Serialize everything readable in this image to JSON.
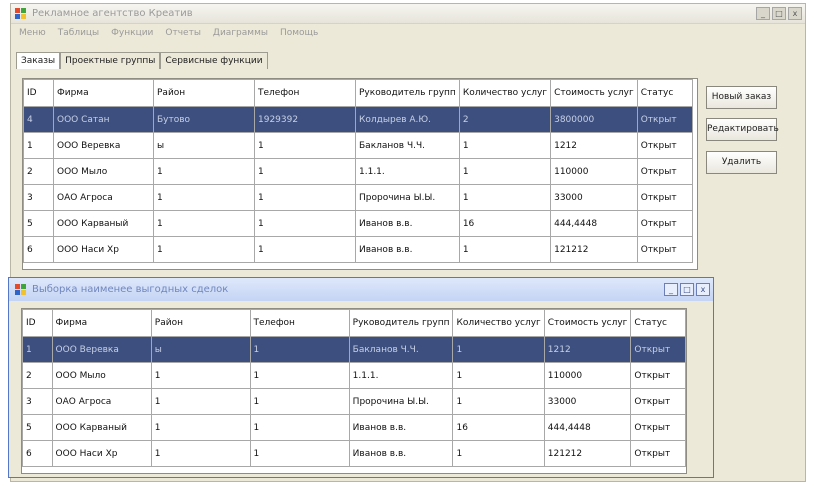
{
  "main_window": {
    "title": "Рекламное агентство Креатив",
    "menu": [
      "Меню",
      "Таблицы",
      "Функции",
      "Отчеты",
      "Диаграммы",
      "Помощь"
    ],
    "tabs": [
      "Заказы",
      "Проектные группы",
      "Сервисные функции"
    ],
    "buttons": {
      "new_order": "Новый заказ",
      "edit": "Редактировать",
      "delete": "Удалить"
    },
    "columns": [
      "ID",
      "Фирма",
      "Район",
      "Телефон",
      "Руководитель групп",
      "Количество услуг",
      "Стоимость услуг",
      "Статус"
    ],
    "rows": [
      [
        "4",
        "ООО Сатан",
        "Бутово",
        "1929392",
        "Колдырев А.Ю.",
        "2",
        "3800000",
        "Открыт"
      ],
      [
        "1",
        "ООО Веревка",
        "ы",
        "1",
        "Бакланов Ч.Ч.",
        "1",
        "1212",
        "Открыт"
      ],
      [
        "2",
        "ООО Мыло",
        "1",
        "1",
        "1.1.1.",
        "1",
        "110000",
        "Открыт"
      ],
      [
        "3",
        "ОАО Агроса",
        "1",
        "1",
        "Пророчина Ы.Ы.",
        "1",
        "33000",
        "Открыт"
      ],
      [
        "5",
        "ООО Карваный",
        "1",
        "1",
        "Иванов в.в.",
        "16",
        "444,4448",
        "Открыт"
      ],
      [
        "6",
        "ООО Наси Хр",
        "1",
        "1",
        "Иванов в.в.",
        "1",
        "121212",
        "Открыт"
      ]
    ]
  },
  "report_window": {
    "title": "Выборка наименее выгодных сделок",
    "columns": [
      "ID",
      "Фирма",
      "Район",
      "Телефон",
      "Руководитель групп",
      "Количество услуг",
      "Стоимость услуг",
      "Статус"
    ],
    "rows": [
      [
        "1",
        "ООО Веревка",
        "ы",
        "1",
        "Бакланов Ч.Ч.",
        "1",
        "1212",
        "Открыт"
      ],
      [
        "2",
        "ООО Мыло",
        "1",
        "1",
        "1.1.1.",
        "1",
        "110000",
        "Открыт"
      ],
      [
        "3",
        "ОАО Агроса",
        "1",
        "1",
        "Пророчина Ы.Ы.",
        "1",
        "33000",
        "Открыт"
      ],
      [
        "5",
        "ООО Карваный",
        "1",
        "1",
        "Иванов в.в.",
        "16",
        "444,4448",
        "Открыт"
      ],
      [
        "6",
        "ООО Наси Хр",
        "1",
        "1",
        "Иванов в.в.",
        "1",
        "121212",
        "Открыт"
      ]
    ]
  },
  "title_buttons": {
    "minimize": "_",
    "maximize": "□",
    "close": "x"
  },
  "colors": {
    "selection": "#3c4f7f",
    "window_bg": "#ece9d8",
    "report_title": "#c4d4f4"
  }
}
